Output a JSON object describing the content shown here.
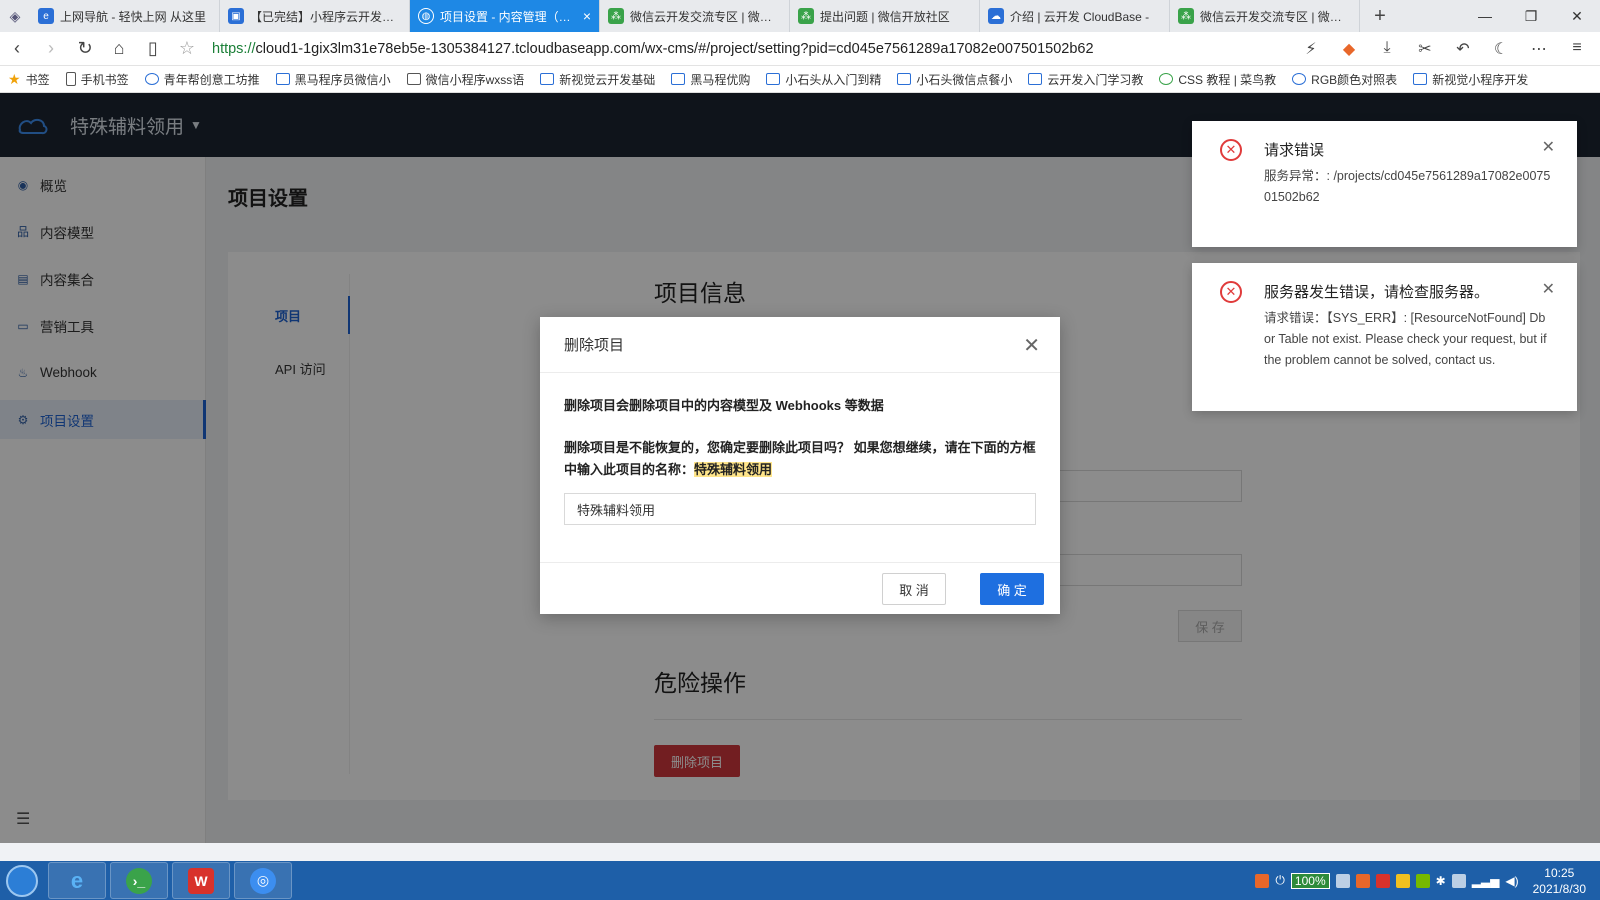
{
  "browser": {
    "tabs": [
      {
        "label": "上网导航 - 轻快上网 从这里",
        "icon_color": "#2b6fd6"
      },
      {
        "label": "【已完结】小程序云开发训练",
        "icon_color": "#2b6fd6"
      },
      {
        "label": "项目设置 - 内容管理（CMS）",
        "icon_color": "#ffffff",
        "active": true
      },
      {
        "label": "微信云开发交流专区 | 微信开",
        "icon_color": "#3aa34a"
      },
      {
        "label": "提出问题 | 微信开放社区",
        "icon_color": "#3aa34a"
      },
      {
        "label": "介绍 | 云开发 CloudBase -",
        "icon_color": "#2b6fd6"
      },
      {
        "label": "微信云开发交流专区 | 微信开",
        "icon_color": "#3aa34a"
      }
    ],
    "url_proto": "https://",
    "url_rest": "cloud1-1gix3lm31e78eb5e-1305384127.tcloudbaseapp.com/wx-cms/#/project/setting?pid=cd045e7561289a17082e007501502b62",
    "bookmarks": [
      "书签",
      "手机书签",
      "青年帮创意工坊推",
      "黑马程序员微信小",
      "微信小程序wxss语",
      "新视觉云开发基础",
      "黑马程优购",
      "小石头从入门到精",
      "小石头微信点餐小",
      "云开发入门学习教",
      "CSS 教程 | 菜鸟教",
      "RGB颜色对照表",
      "新视觉小程序开发"
    ]
  },
  "app": {
    "project_name": "特殊辅料领用",
    "sidebar": [
      {
        "label": "概览",
        "icon": "eye-icon"
      },
      {
        "label": "内容模型",
        "icon": "model-icon"
      },
      {
        "label": "内容集合",
        "icon": "collection-icon"
      },
      {
        "label": "营销工具",
        "icon": "bag-icon"
      },
      {
        "label": "Webhook",
        "icon": "webhook-icon"
      },
      {
        "label": "项目设置",
        "icon": "gear-icon",
        "active": true
      }
    ],
    "page_title": "项目设置",
    "subnav": [
      {
        "label": "项目",
        "active": true
      },
      {
        "label": "API 访问"
      }
    ],
    "section_info_title": "项目信息",
    "save_label": "保 存",
    "section_danger_title": "危险操作",
    "delete_project_label": "删除项目"
  },
  "modal": {
    "title": "删除项目",
    "line1": "删除项目会删除项目中的内容模型及 Webhooks 等数据",
    "line2": "删除项目是不能恢复的，您确定要删除此项目吗？ 如果您想继续，请在下面的方框中输入此项目的名称：",
    "highlight_name": "特殊辅料领用",
    "input_value": "特殊辅料领用",
    "cancel_label": "取 消",
    "ok_label": "确 定"
  },
  "notifications": [
    {
      "title": "请求错误",
      "message": "服务异常：: /projects/cd045e7561289a17082e007501502b62"
    },
    {
      "title": "服务器发生错误，请检查服务器。",
      "message": "请求错误：【SYS_ERR】: [ResourceNotFound] Db or Table not exist. Please check your request, but if the problem cannot be solved, contact us."
    }
  ],
  "taskbar": {
    "battery": "100%",
    "time": "10:25",
    "date": "2021/8/30"
  },
  "colors": {
    "primary": "#1e63d3",
    "danger": "#d0373c",
    "header_bg": "#1c2532",
    "error": "#e03b3b"
  }
}
